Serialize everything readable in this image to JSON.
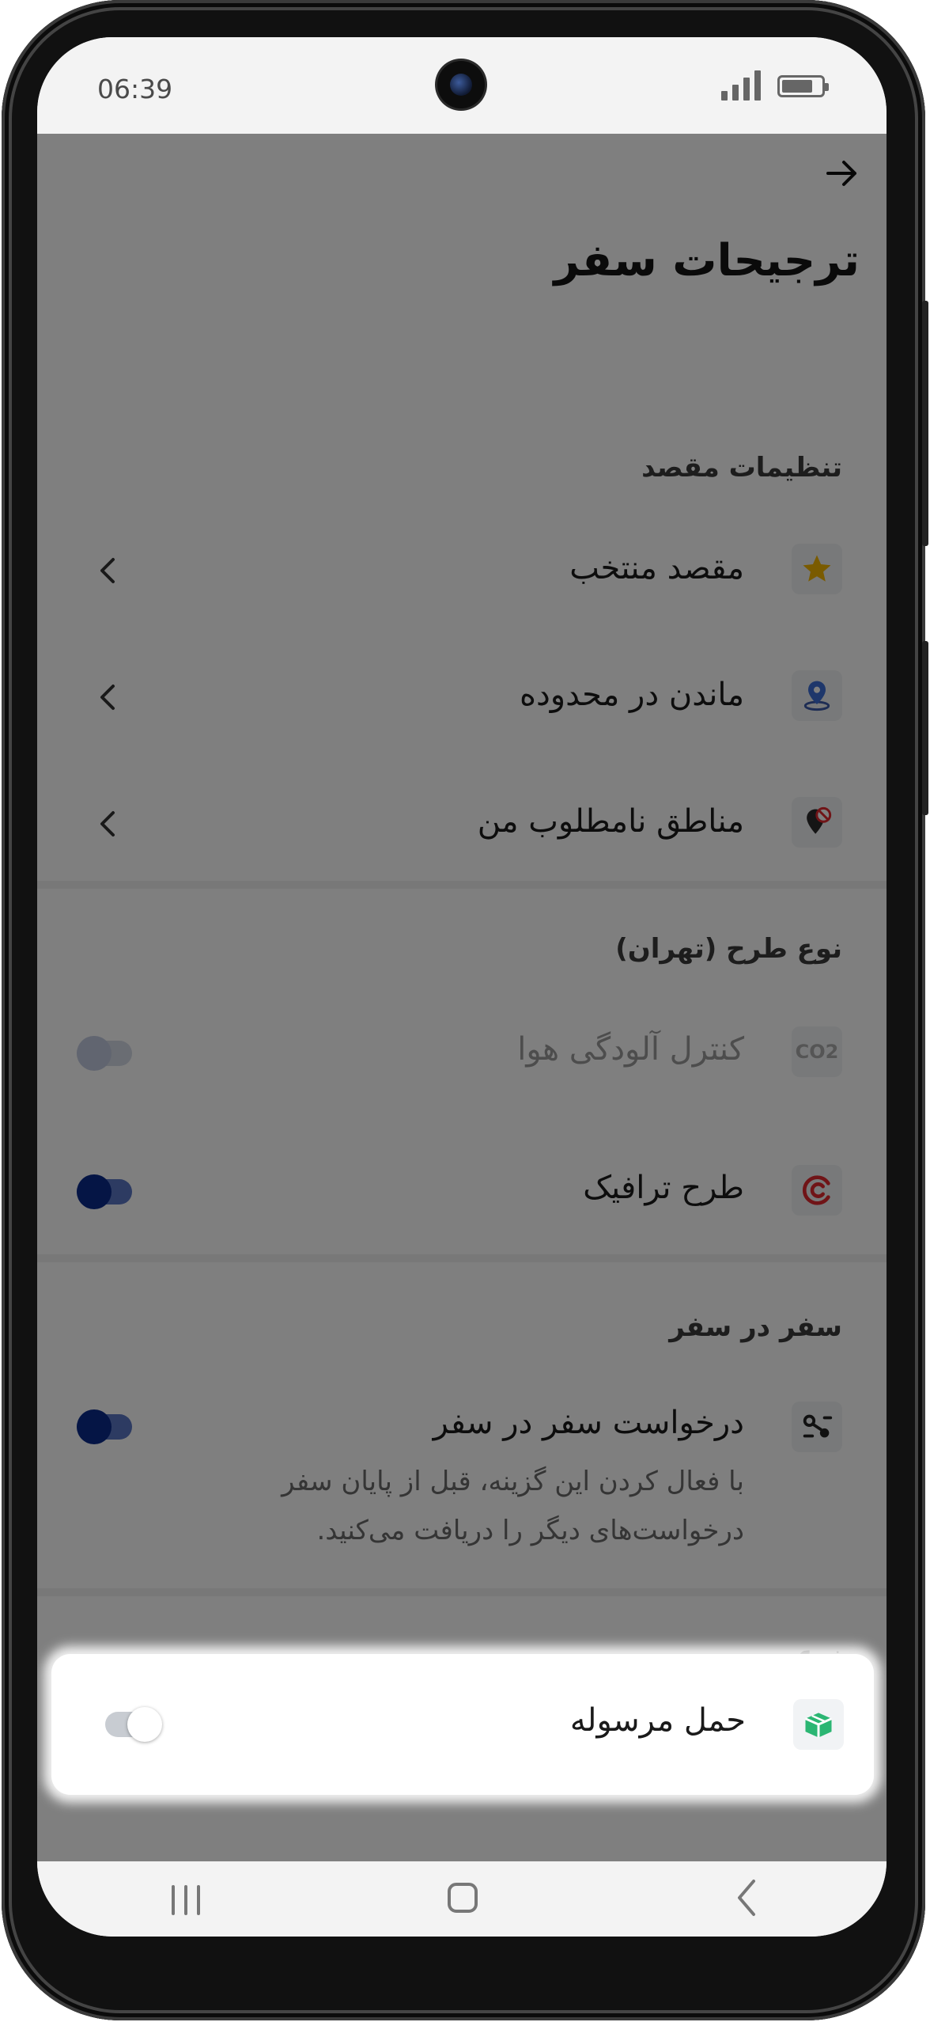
{
  "status_bar": {
    "time": "06:39"
  },
  "header": {
    "title": "ترجیحات سفر"
  },
  "sections": {
    "destination": {
      "title": "تنظیمات مقصد",
      "items": [
        {
          "label": "مقصد منتخب"
        },
        {
          "label": "ماندن در محدوده"
        },
        {
          "label": "مناطق نامطلوب من"
        }
      ]
    },
    "plan_type": {
      "title": "نوع طرح (تهران)",
      "items": [
        {
          "label": "کنترل آلودگی هوا",
          "icon_text": "CO2",
          "toggle": "off",
          "disabled": true
        },
        {
          "label": "طرح ترافیک",
          "toggle": "on"
        }
      ]
    },
    "in_trip": {
      "title": "سفر در سفر",
      "item": {
        "label": "درخواست سفر در سفر",
        "description": "با فعال کردن این گزینه، قبل از پایان سفر درخواست‌های دیگر را دریافت می‌کنید.",
        "toggle": "on"
      }
    },
    "service_type": {
      "title": "نوع سرویس",
      "item": {
        "label": "حمل مرسوله",
        "toggle": "off"
      }
    }
  },
  "icons": {
    "back": "arrow-right-icon",
    "destination_items": [
      "star-icon",
      "location-pin-icon",
      "blocked-location-icon"
    ],
    "plan_type_items": [
      "co2-icon",
      "traffic-plan-icon"
    ],
    "in_trip": "route-icon",
    "service_type": "package-icon"
  },
  "colors": {
    "accent": "#0a2a8a",
    "star": "#f5b700",
    "traffic": "#e0282e",
    "package": "#2bb673"
  }
}
